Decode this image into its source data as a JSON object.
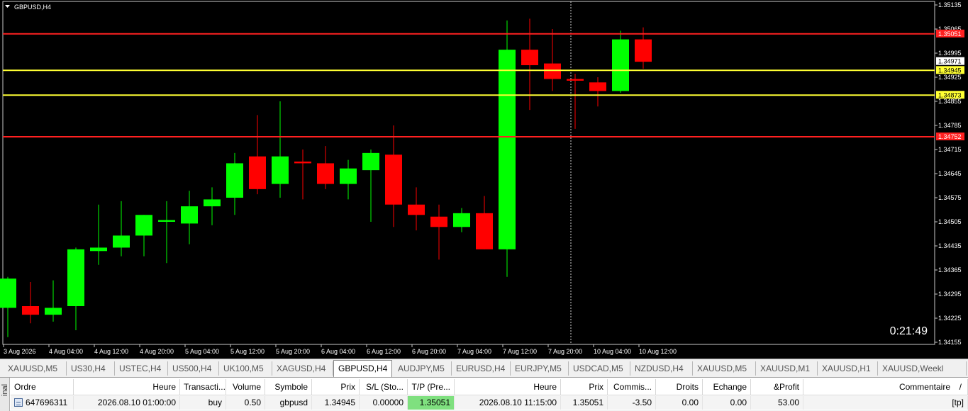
{
  "chart": {
    "title": "GBPUSD,H4",
    "countdown": "0:21:49",
    "price_min": 1.34155,
    "price_max": 1.35135,
    "price_ticks": [
      "1.35135",
      "1.35065",
      "1.34995",
      "1.34925",
      "1.34855",
      "1.34785",
      "1.34715",
      "1.34645",
      "1.34575",
      "1.34505",
      "1.34435",
      "1.34365",
      "1.34295",
      "1.34225",
      "1.34155"
    ],
    "time_labels": [
      "3 Aug 2026",
      "4 Aug 04:00",
      "4 Aug 12:00",
      "4 Aug 20:00",
      "5 Aug 04:00",
      "5 Aug 12:00",
      "5 Aug 20:00",
      "6 Aug 04:00",
      "6 Aug 12:00",
      "6 Aug 20:00",
      "7 Aug 04:00",
      "7 Aug 12:00",
      "7 Aug 20:00",
      "10 Aug 04:00",
      "10 Aug 12:00"
    ],
    "lines": [
      {
        "price": 1.35051,
        "label": "1.35051",
        "color": "#ff2020",
        "label_bg": "#ff2020",
        "label_fg": "#ffffff"
      },
      {
        "price": 1.34945,
        "label": "1.34945",
        "color": "#ffff33",
        "label_bg": "#ffff33",
        "label_fg": "#000000"
      },
      {
        "price": 1.34873,
        "label": "1.34873",
        "color": "#ffff33",
        "label_bg": "#ffff33",
        "label_fg": "#000000"
      },
      {
        "price": 1.34752,
        "label": "1.34752",
        "color": "#ff2020",
        "label_bg": "#ff2020",
        "label_fg": "#ffffff"
      }
    ],
    "bid_label": "1.34971",
    "colors": {
      "bull": "#00ff00",
      "bear": "#ff0000",
      "background": "#000000",
      "axis_text": "#ffffff"
    }
  },
  "chart_data": {
    "type": "candlestick",
    "symbol": "GBPUSD",
    "timeframe": "H4",
    "ylim": [
      1.34155,
      1.35135
    ],
    "candles": [
      {
        "o": 1.34255,
        "h": 1.34345,
        "l": 1.3417,
        "c": 1.3434
      },
      {
        "o": 1.3426,
        "h": 1.3433,
        "l": 1.3421,
        "c": 1.34235
      },
      {
        "o": 1.34235,
        "h": 1.34335,
        "l": 1.34215,
        "c": 1.34255
      },
      {
        "o": 1.3426,
        "h": 1.3443,
        "l": 1.3419,
        "c": 1.34425
      },
      {
        "o": 1.3442,
        "h": 1.34555,
        "l": 1.3438,
        "c": 1.3443
      },
      {
        "o": 1.3443,
        "h": 1.34565,
        "l": 1.34405,
        "c": 1.34465
      },
      {
        "o": 1.34465,
        "h": 1.34525,
        "l": 1.34405,
        "c": 1.34525
      },
      {
        "o": 1.34505,
        "h": 1.34565,
        "l": 1.34385,
        "c": 1.3451
      },
      {
        "o": 1.345,
        "h": 1.34595,
        "l": 1.3444,
        "c": 1.3455
      },
      {
        "o": 1.3455,
        "h": 1.34605,
        "l": 1.34495,
        "c": 1.3457
      },
      {
        "o": 1.34575,
        "h": 1.34705,
        "l": 1.34525,
        "c": 1.34675
      },
      {
        "o": 1.34695,
        "h": 1.34815,
        "l": 1.34585,
        "c": 1.346
      },
      {
        "o": 1.34615,
        "h": 1.34855,
        "l": 1.34575,
        "c": 1.34695
      },
      {
        "o": 1.3468,
        "h": 1.34715,
        "l": 1.3457,
        "c": 1.34675
      },
      {
        "o": 1.34675,
        "h": 1.34725,
        "l": 1.346,
        "c": 1.34615
      },
      {
        "o": 1.34615,
        "h": 1.34685,
        "l": 1.3457,
        "c": 1.3466
      },
      {
        "o": 1.34655,
        "h": 1.34715,
        "l": 1.34505,
        "c": 1.34705
      },
      {
        "o": 1.347,
        "h": 1.34785,
        "l": 1.3449,
        "c": 1.34555
      },
      {
        "o": 1.34555,
        "h": 1.34605,
        "l": 1.3448,
        "c": 1.34525
      },
      {
        "o": 1.3452,
        "h": 1.34555,
        "l": 1.34395,
        "c": 1.3449
      },
      {
        "o": 1.3449,
        "h": 1.34545,
        "l": 1.34475,
        "c": 1.3453
      },
      {
        "o": 1.3453,
        "h": 1.3458,
        "l": 1.34425,
        "c": 1.34425
      },
      {
        "o": 1.34425,
        "h": 1.3509,
        "l": 1.34345,
        "c": 1.35005
      },
      {
        "o": 1.35005,
        "h": 1.35095,
        "l": 1.3483,
        "c": 1.3496
      },
      {
        "o": 1.34965,
        "h": 1.35065,
        "l": 1.34885,
        "c": 1.3492
      },
      {
        "o": 1.3492,
        "h": 1.34935,
        "l": 1.34775,
        "c": 1.34915
      },
      {
        "o": 1.3491,
        "h": 1.34925,
        "l": 1.3484,
        "c": 1.34885
      },
      {
        "o": 1.34885,
        "h": 1.3506,
        "l": 1.3488,
        "c": 1.35035
      },
      {
        "o": 1.35035,
        "h": 1.3507,
        "l": 1.3495,
        "c": 1.3497
      }
    ]
  },
  "tabs": [
    {
      "label": "XAUUSD,M5",
      "active": false
    },
    {
      "label": "US30,H4",
      "active": false
    },
    {
      "label": "USTEC,H4",
      "active": false
    },
    {
      "label": "US500,H4",
      "active": false
    },
    {
      "label": "UK100,M5",
      "active": false
    },
    {
      "label": "XAGUSD,H4",
      "active": false
    },
    {
      "label": "GBPUSD,H4",
      "active": true
    },
    {
      "label": "AUDJPY,M5",
      "active": false
    },
    {
      "label": "EURUSD,H4",
      "active": false
    },
    {
      "label": "EURJPY,M5",
      "active": false
    },
    {
      "label": "USDCAD,M5",
      "active": false
    },
    {
      "label": "NZDUSD,H4",
      "active": false
    },
    {
      "label": "XAUUSD,M5",
      "active": false
    },
    {
      "label": "XAUUSD,M1",
      "active": false
    },
    {
      "label": "XAUUSD,H1",
      "active": false
    },
    {
      "label": "XAUUSD,Weekl",
      "active": false
    }
  ],
  "terminal": {
    "side_label": "inal",
    "headers": [
      "Ordre",
      "Heure",
      "Transacti...",
      "Volume",
      "Symbole",
      "Prix",
      "S/L (Sto...",
      "T/P (Pre...",
      "Heure",
      "Prix",
      "Commis...",
      "Droits",
      "Echange",
      "&Profit",
      "Commentaire"
    ],
    "sort_arrow": "/",
    "row": [
      "647696311",
      "2026.08.10 01:00:00",
      "buy",
      "0.50",
      "gbpusd",
      "1.34945",
      "0.00000",
      "1.35051",
      "2026.08.10 11:15:00",
      "1.35051",
      "-3.50",
      "0.00",
      "0.00",
      "53.00",
      "[tp]"
    ]
  }
}
